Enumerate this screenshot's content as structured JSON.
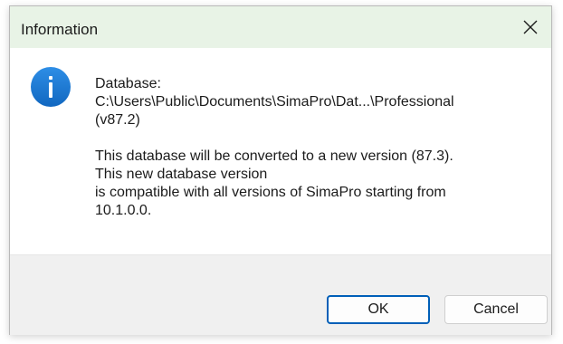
{
  "window": {
    "title": "Information",
    "titlebar_color": "#e8f3e6"
  },
  "icons": {
    "info": "info-icon",
    "close": "close-icon",
    "accent": "#1f7fd6"
  },
  "message": {
    "lines": [
      "Database:",
      "C:\\Users\\Public\\Documents\\SimaPro\\Dat...\\Professional",
      "(v87.2)",
      "",
      "This database will be converted to a new version (87.3).",
      "This new database version",
      "is compatible with all versions of SimaPro starting from",
      "10.1.0.0."
    ]
  },
  "buttons": {
    "ok_label": "OK",
    "cancel_label": "Cancel"
  }
}
